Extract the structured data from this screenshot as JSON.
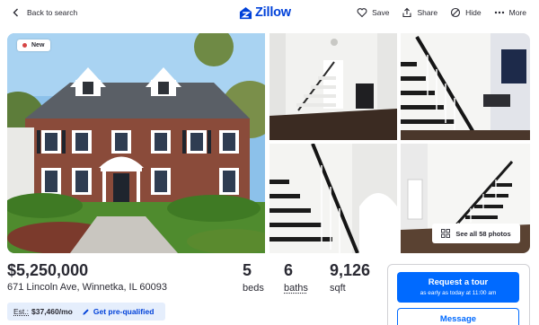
{
  "header": {
    "back_label": "Back to search",
    "logo_text": "Zillow",
    "actions": [
      {
        "label": "Save",
        "icon": "heart-icon"
      },
      {
        "label": "Share",
        "icon": "share-icon"
      },
      {
        "label": "Hide",
        "icon": "hide-icon"
      },
      {
        "label": "More",
        "icon": "more-icon"
      }
    ]
  },
  "gallery": {
    "badge": "New",
    "see_all_label": "See all 58 photos"
  },
  "listing": {
    "price": "$5,250,000",
    "address": "671 Lincoln Ave, Winnetka, IL 60093",
    "beds": "5",
    "beds_label": "beds",
    "baths": "6",
    "baths_label": "baths",
    "sqft": "9,126",
    "sqft_label": "sqft",
    "est_label": "Est.:",
    "est_value": "$37,460/mo",
    "prequal_label": "Get pre-qualified"
  },
  "contact": {
    "tour_label": "Request a tour",
    "tour_sub": "as early as today at 11:00 am",
    "message_label": "Message"
  },
  "colors": {
    "brand": "#0041d9",
    "primary_button": "#006aff",
    "est_bg": "#e5eefc",
    "new_dot": "#d64545"
  }
}
